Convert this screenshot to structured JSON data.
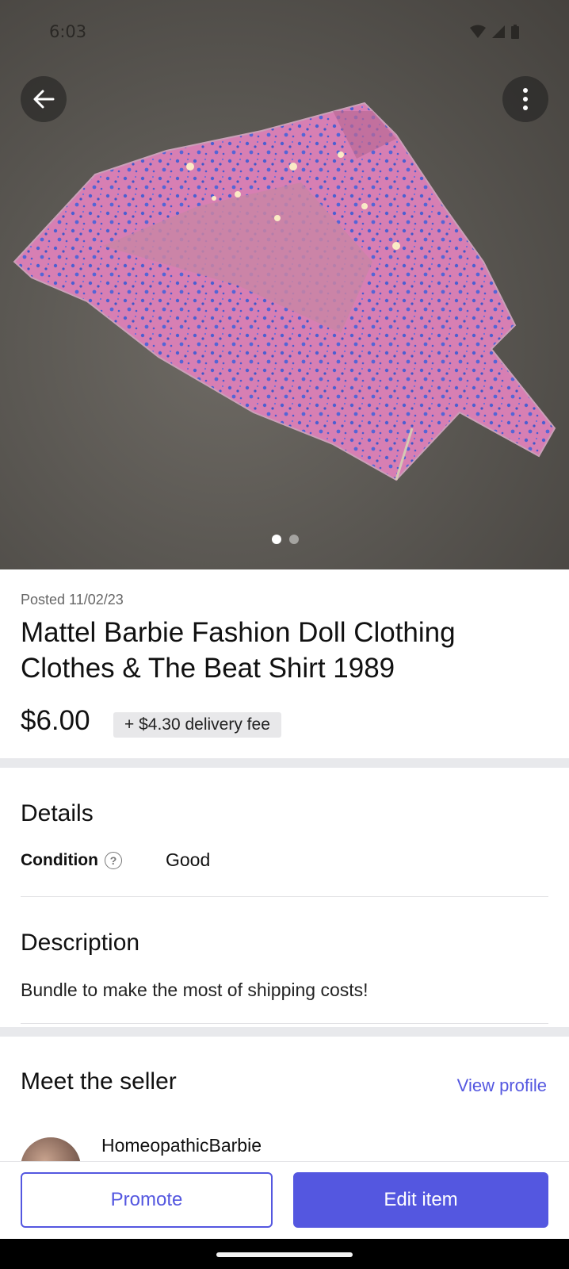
{
  "status_bar": {
    "time": "6:03"
  },
  "image_gallery": {
    "image_count": 2,
    "active_index": 0
  },
  "listing": {
    "posted": "Posted 11/02/23",
    "title": "Mattel Barbie Fashion Doll Clothing Clothes & The Beat Shirt 1989",
    "price": "$6.00",
    "delivery_fee": "+ $4.30 delivery fee"
  },
  "details": {
    "heading": "Details",
    "condition_label": "Condition",
    "condition_help_icon": "question-circle-icon",
    "condition_value": "Good"
  },
  "description": {
    "heading": "Description",
    "text": "Bundle to make the most of shipping costs!"
  },
  "seller": {
    "heading": "Meet the seller",
    "view_profile_label": "View profile",
    "name": "HomeopathicBarbie"
  },
  "actions": {
    "promote_label": "Promote",
    "edit_label": "Edit item"
  },
  "colors": {
    "accent": "#5457e0",
    "divider": "#e8e9ec"
  }
}
